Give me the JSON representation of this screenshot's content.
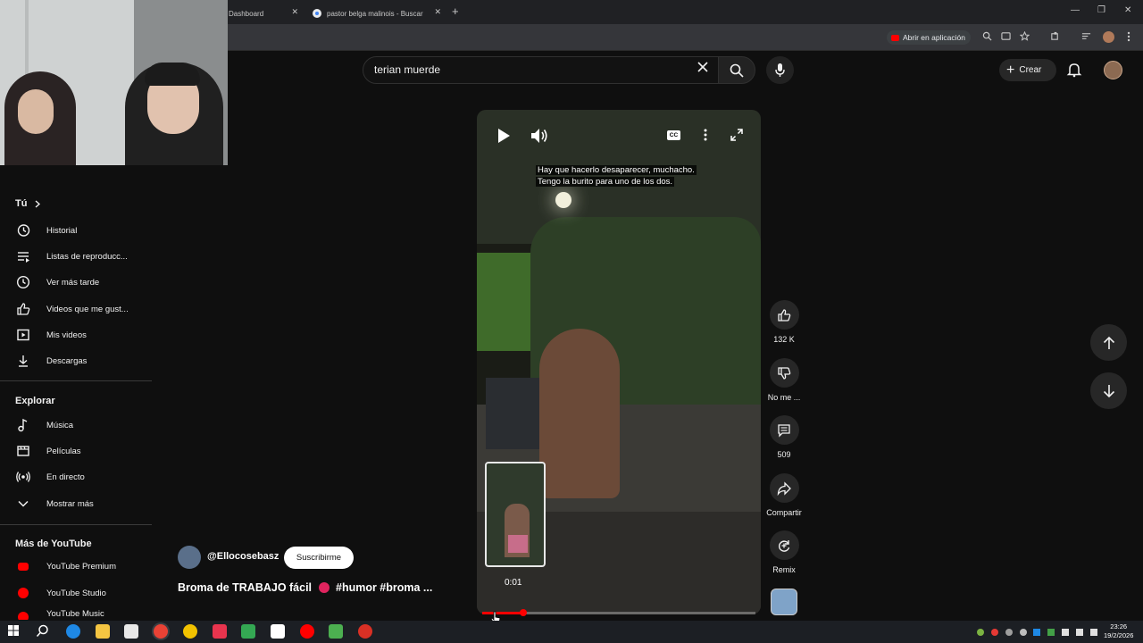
{
  "browser": {
    "tabs": [
      {
        "title": "Dashboard"
      },
      {
        "title": "pastor belga malinois - Buscar"
      }
    ],
    "open_in_app_label": "Abrir en aplicación",
    "close_glyph": "✕",
    "new_tab_glyph": "+",
    "window_controls": [
      "—",
      "❐",
      "✕"
    ]
  },
  "masthead": {
    "search_query": "terian muerde",
    "create_label": "Crear"
  },
  "sidebar": {
    "you_header": "Tú",
    "you_items": [
      {
        "label": "Historial",
        "icon": "history-icon"
      },
      {
        "label": "Listas de reproducc...",
        "icon": "playlist-icon"
      },
      {
        "label": "Ver más tarde",
        "icon": "clock-icon"
      },
      {
        "label": "Videos que me gust...",
        "icon": "thumbs-up-icon"
      },
      {
        "label": "Mis videos",
        "icon": "my-videos-icon"
      },
      {
        "label": "Descargas",
        "icon": "download-icon"
      }
    ],
    "explore_header": "Explorar",
    "explore_items": [
      {
        "label": "Música",
        "icon": "music-icon"
      },
      {
        "label": "Películas",
        "icon": "film-icon"
      },
      {
        "label": "En directo",
        "icon": "live-icon"
      },
      {
        "label": "Mostrar más",
        "icon": "chevron-down-icon"
      }
    ],
    "more_header": "Más de YouTube",
    "more_items": [
      {
        "label": "YouTube Premium",
        "icon": "youtube-premium-icon"
      },
      {
        "label": "YouTube Studio",
        "icon": "youtube-studio-icon"
      },
      {
        "label": "YouTube Music",
        "icon": "youtube-music-icon"
      }
    ]
  },
  "player": {
    "caption_line1": "Hay que hacerlo desaparecer, muchacho.",
    "caption_line2": "Tengo la burito para uno de los dos.",
    "cc_label": "CC",
    "current_time": "0:01",
    "progress_fraction": 0.15
  },
  "video": {
    "channel": "@Ellocosebasz",
    "subscribe_label": "Suscribirme",
    "title_part1": "Broma de TRABAJO fácil",
    "title_part2": "#humor #broma ..."
  },
  "actions": {
    "likes": "132 K",
    "dislike_label": "No me ...",
    "comments": "509",
    "share_label": "Compartir",
    "remix_label": "Remix"
  },
  "taskbar": {
    "time": "23:26",
    "date": "19/2/2026"
  },
  "colors": {
    "accent_red": "#ff0000",
    "background": "#0f0f0f",
    "chip_bg": "#272727"
  }
}
